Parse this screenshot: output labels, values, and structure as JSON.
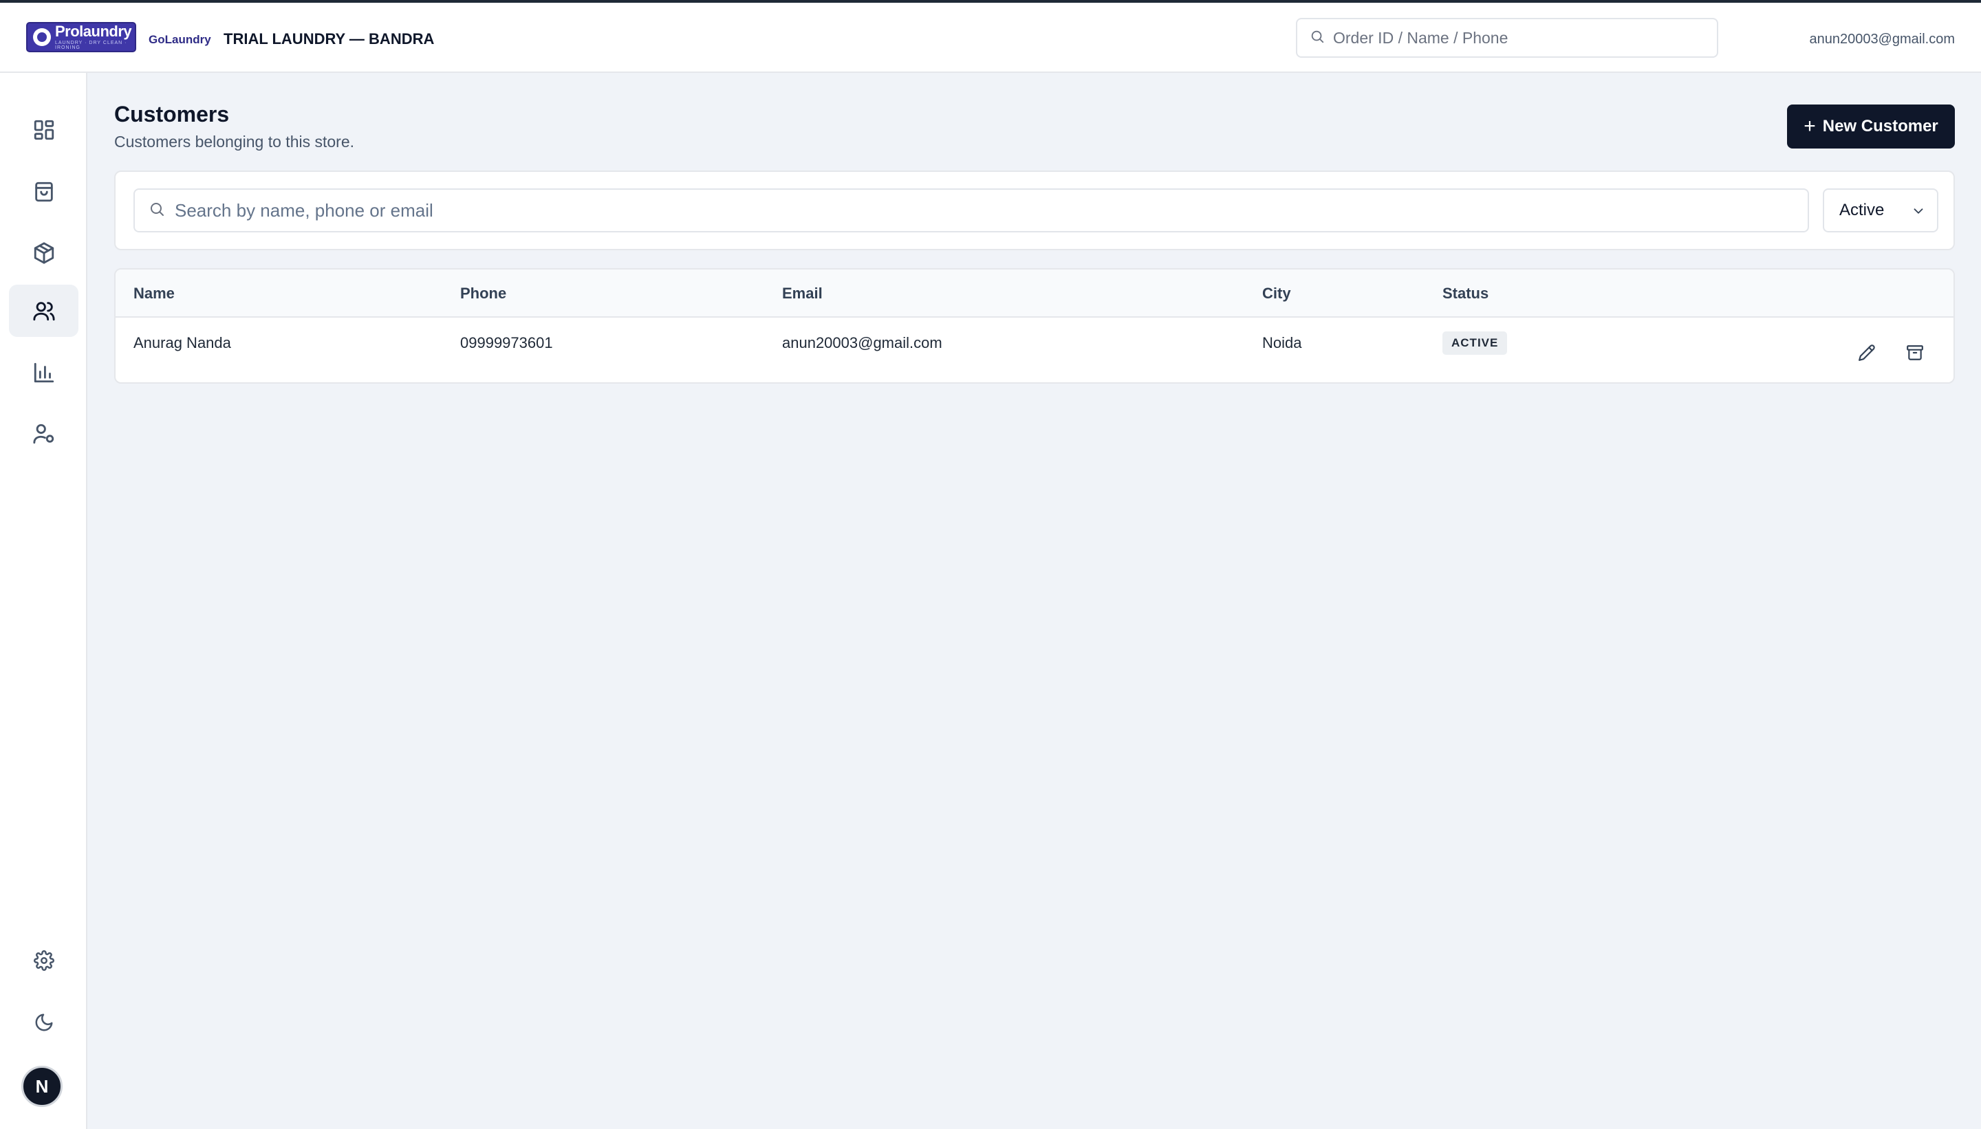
{
  "header": {
    "logo_text": "Prolaundry",
    "logo_tagline": "LAUNDRY · DRY CLEAN · IRONING",
    "brand_sub": "GoLaundry",
    "store_name": "TRIAL LAUNDRY — BANDRA",
    "search_placeholder": "Order ID / Name / Phone",
    "user_email": "anun20003@gmail.com"
  },
  "sidebar": {
    "items": [
      {
        "icon": "dashboard-icon",
        "active": false
      },
      {
        "icon": "shopping-bag-icon",
        "active": false
      },
      {
        "icon": "package-icon",
        "active": false
      },
      {
        "icon": "users-icon",
        "active": true
      },
      {
        "icon": "bar-chart-icon",
        "active": false
      },
      {
        "icon": "user-settings-icon",
        "active": false
      }
    ],
    "bottom": [
      "gear-icon",
      "moon-icon"
    ],
    "avatar_initial": "N"
  },
  "page": {
    "title": "Customers",
    "subtitle": "Customers belonging to this store.",
    "new_button_label": "New Customer"
  },
  "filters": {
    "search_placeholder": "Search by name, phone or email",
    "status_selected": "Active"
  },
  "table": {
    "columns": [
      "Name",
      "Phone",
      "Email",
      "City",
      "Status"
    ],
    "rows": [
      {
        "name": "Anurag Nanda",
        "phone": "09999973601",
        "email": "anun20003@gmail.com",
        "city": "Noida",
        "status": "ACTIVE"
      }
    ]
  },
  "colors": {
    "primary_button": "#0f172a",
    "logo_bg": "#3f37a8",
    "page_bg": "#f0f3f8"
  }
}
